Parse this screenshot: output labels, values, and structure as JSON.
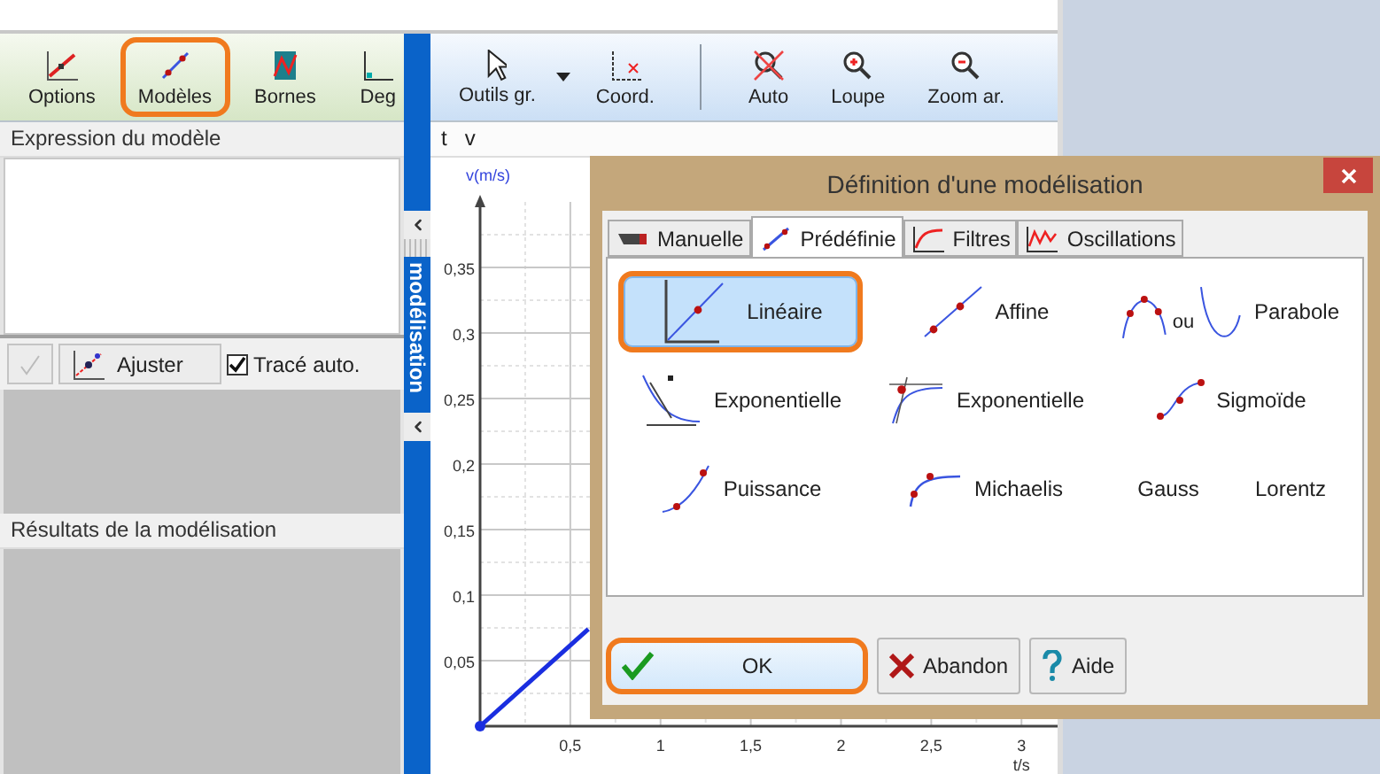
{
  "left_toolbar": [
    {
      "label": "Options",
      "kind": "options",
      "highlighted": false
    },
    {
      "label": "Modèles",
      "kind": "models",
      "highlighted": true
    },
    {
      "label": "Bornes",
      "kind": "bounds",
      "highlighted": false
    },
    {
      "label": "Deg",
      "kind": "degree",
      "highlighted": false
    }
  ],
  "expression_panel": {
    "title": "Expression du modèle"
  },
  "fit_row": {
    "validate_disabled": true,
    "fit_button": "Ajuster",
    "auto_trace": {
      "label": "Tracé auto.",
      "checked": true
    }
  },
  "results_panel": {
    "title": "Résultats de la modélisation"
  },
  "side_strip": {
    "label": "modélisation"
  },
  "graph": {
    "toolbar_groups": [
      [
        {
          "label": "Outils gr.",
          "kind": "pointer"
        },
        {
          "kind": "menu-caret"
        },
        {
          "label": "Coord.",
          "kind": "coords"
        }
      ],
      [
        {
          "label": "Auto",
          "kind": "auto"
        },
        {
          "label": "Loupe",
          "kind": "zoom-in"
        },
        {
          "label": "Zoom ar.",
          "kind": "zoom-out"
        }
      ]
    ],
    "variables": [
      "t",
      "v"
    ],
    "chart_data": {
      "type": "line",
      "xlabel": "t/s",
      "ylabel": "v(m/s)",
      "x": [
        0,
        0.6
      ],
      "series": [
        {
          "color": "#1a2ee0",
          "values": [
            0,
            0.074
          ]
        }
      ],
      "xlim": [
        0,
        3.2
      ],
      "ylim": [
        0,
        0.4
      ],
      "grid": true,
      "xticks": [
        {
          "value": 0.5,
          "label": "0,5"
        },
        {
          "value": 1,
          "label": "1"
        },
        {
          "value": 1.5,
          "label": "1,5"
        },
        {
          "value": 2,
          "label": "2"
        },
        {
          "value": 2.5,
          "label": "2,5"
        },
        {
          "value": 3,
          "label": "3"
        }
      ],
      "yticks": [
        {
          "value": 0.05,
          "label": "0,05"
        },
        {
          "value": 0.1,
          "label": "0,1"
        },
        {
          "value": 0.15,
          "label": "0,15"
        },
        {
          "value": 0.2,
          "label": "0,2"
        },
        {
          "value": 0.25,
          "label": "0,25"
        },
        {
          "value": 0.3,
          "label": "0,3"
        },
        {
          "value": 0.35,
          "label": "0,35"
        }
      ]
    }
  },
  "dialog": {
    "title": "Définition d'une modélisation",
    "tabs": [
      {
        "label": "Manuelle",
        "kind": "manual",
        "selected": false
      },
      {
        "label": "Prédéfinie",
        "kind": "predefined",
        "selected": true
      },
      {
        "label": "Filtres",
        "kind": "filters",
        "selected": false
      },
      {
        "label": "Oscillations",
        "kind": "oscillations",
        "selected": false
      }
    ],
    "models": [
      {
        "label": "Linéaire",
        "kind": "linear",
        "selected": true,
        "highlighted": true
      },
      {
        "label": "Affine",
        "kind": "affine",
        "selected": false,
        "highlighted": false
      },
      {
        "label": "Parabole",
        "kind": "parabola",
        "selected": false,
        "highlighted": false,
        "joiner": "ou"
      },
      {
        "label": "Exponentielle",
        "kind": "decay",
        "selected": false,
        "highlighted": false
      },
      {
        "label": "Exponentielle",
        "kind": "rise",
        "selected": false,
        "highlighted": false
      },
      {
        "label": "Sigmoïde",
        "kind": "sigmoid",
        "selected": false,
        "highlighted": false
      },
      {
        "label": "Puissance",
        "kind": "power",
        "selected": false,
        "highlighted": false
      },
      {
        "label": "Michaelis",
        "kind": "michaelis",
        "selected": false,
        "highlighted": false
      },
      {
        "label": "Gauss",
        "kind": "plain",
        "selected": false,
        "highlighted": false
      },
      {
        "label": "Lorentz",
        "kind": "plain",
        "selected": false,
        "highlighted": false
      }
    ],
    "buttons": [
      {
        "label": "OK",
        "kind": "ok",
        "highlighted": true
      },
      {
        "label": "Abandon",
        "kind": "cancel",
        "highlighted": false
      },
      {
        "label": "Aide",
        "kind": "help",
        "highlighted": false
      }
    ]
  }
}
